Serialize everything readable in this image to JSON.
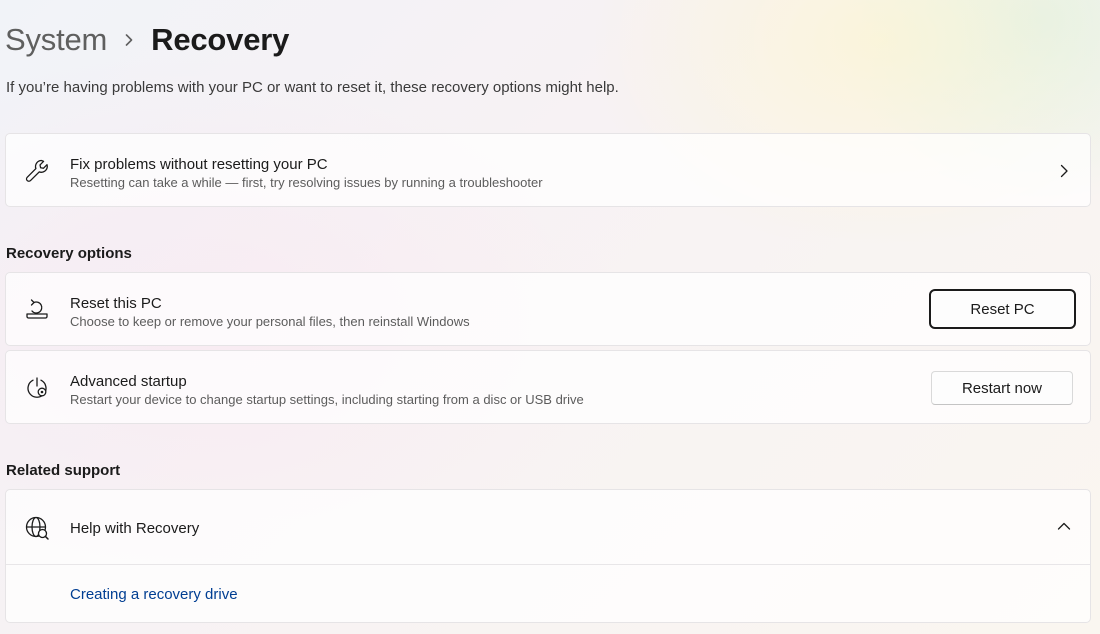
{
  "breadcrumb": {
    "parent": "System",
    "current": "Recovery"
  },
  "subtitle": "If you’re having problems with your PC or want to reset it, these recovery options might help.",
  "fix_problems": {
    "title": "Fix problems without resetting your PC",
    "description": "Resetting can take a while — first, try resolving issues by running a troubleshooter",
    "icon": "wrench-icon"
  },
  "recovery_options": {
    "heading": "Recovery options",
    "reset": {
      "title": "Reset this PC",
      "description": "Choose to keep or remove your personal files, then reinstall Windows",
      "button": "Reset PC",
      "icon": "reset-pc-icon"
    },
    "advanced": {
      "title": "Advanced startup",
      "description": "Restart your device to change startup settings, including starting from a disc or USB drive",
      "button": "Restart now",
      "icon": "advanced-startup-icon"
    }
  },
  "related_support": {
    "heading": "Related support",
    "help": {
      "title": "Help with Recovery",
      "icon": "globe-help-icon",
      "expanded": true,
      "links": [
        "Creating a recovery drive"
      ]
    }
  },
  "colors": {
    "link": "#003e92",
    "text": "#1b1b1b",
    "secondary_text": "#5c5c5c"
  }
}
